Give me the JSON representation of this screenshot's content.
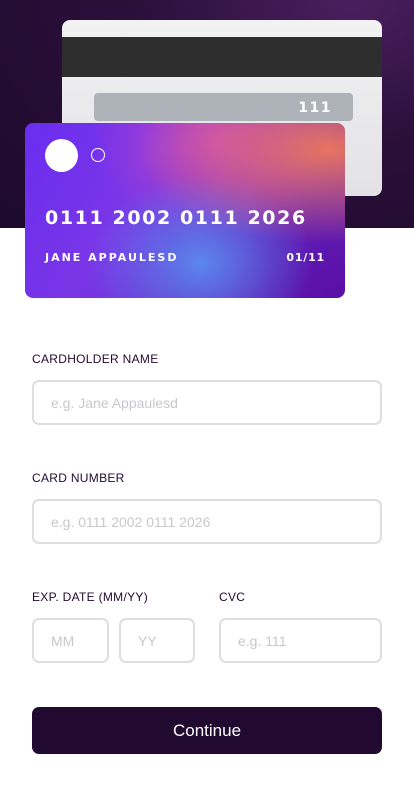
{
  "card_back": {
    "cvc": "111"
  },
  "card_front": {
    "number": "0111 2002 0111 2026",
    "holder": "JANE APPAULESD",
    "expiry": "01/11"
  },
  "form": {
    "name_label": "CARDHOLDER NAME",
    "name_placeholder": "e.g. Jane Appaulesd",
    "number_label": "CARD NUMBER",
    "number_placeholder": "e.g. 0111 2002 0111 2026",
    "exp_label": "EXP. DATE (MM/YY)",
    "mm_placeholder": "MM",
    "yy_placeholder": "YY",
    "cvc_label": "CVC",
    "cvc_placeholder": "e.g. 111",
    "submit_label": "Continue"
  },
  "colors": {
    "dark_violet": "#21092f",
    "input_border": "#dedddf",
    "placeholder": "#c9c7cc"
  }
}
